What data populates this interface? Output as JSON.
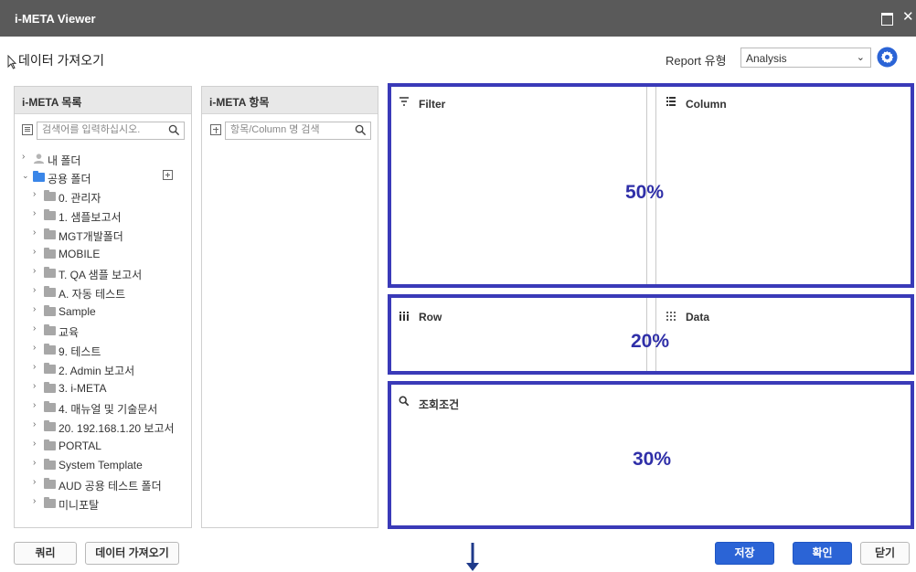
{
  "window": {
    "title": "i-META Viewer"
  },
  "header": {
    "title": "데이터 가져오기",
    "report_type_label": "Report 유형",
    "report_type_value": "Analysis"
  },
  "meta_list": {
    "title": "i-META 목록",
    "search_placeholder": "검색어를 입력하십시오.",
    "tree": [
      {
        "label": "내 폴더"
      },
      {
        "label": "공용 폴더"
      },
      {
        "label": "0. 관리자"
      },
      {
        "label": "1. 샘플보고서"
      },
      {
        "label": "MGT개발폴더"
      },
      {
        "label": "MOBILE"
      },
      {
        "label": "T. QA 샘플 보고서"
      },
      {
        "label": "A. 자동 테스트"
      },
      {
        "label": "Sample"
      },
      {
        "label": "교육"
      },
      {
        "label": "9. 테스트"
      },
      {
        "label": "2. Admin 보고서"
      },
      {
        "label": "3. i-META"
      },
      {
        "label": "4. 매뉴얼 및 기술문서"
      },
      {
        "label": "20. 192.168.1.20 보고서"
      },
      {
        "label": "PORTAL"
      },
      {
        "label": "System Template"
      },
      {
        "label": "AUD 공용 테스트 폴더"
      },
      {
        "label": "미니포탈"
      }
    ]
  },
  "meta_items": {
    "title": "i-META 항목",
    "search_placeholder": "항목/Column 명 검색"
  },
  "zones": {
    "filter": {
      "label": "Filter"
    },
    "column": {
      "label": "Column"
    },
    "row": {
      "label": "Row"
    },
    "data": {
      "label": "Data"
    },
    "condition": {
      "label": "조회조건"
    },
    "top_pct": "50%",
    "middle_pct": "20%",
    "bottom_pct": "30%"
  },
  "footer": {
    "query_button": "쿼리",
    "import_button": "데이터 가져오기",
    "save_button": "저장",
    "confirm_button": "확인",
    "close_button": "닫기"
  },
  "colors": {
    "titlebar": "#5a5a5a",
    "zone_border": "#3a3ab8",
    "primary_button": "#2b64d6",
    "folder_gray": "#a7a7a7",
    "folder_blue": "#3a86e8"
  },
  "icons": [
    "maximize-icon",
    "close-icon",
    "gear-icon",
    "search-icon",
    "folder-icon",
    "person-icon",
    "filter-icon",
    "column-icon",
    "row-icon",
    "data-icon",
    "down-arrow-icon"
  ]
}
